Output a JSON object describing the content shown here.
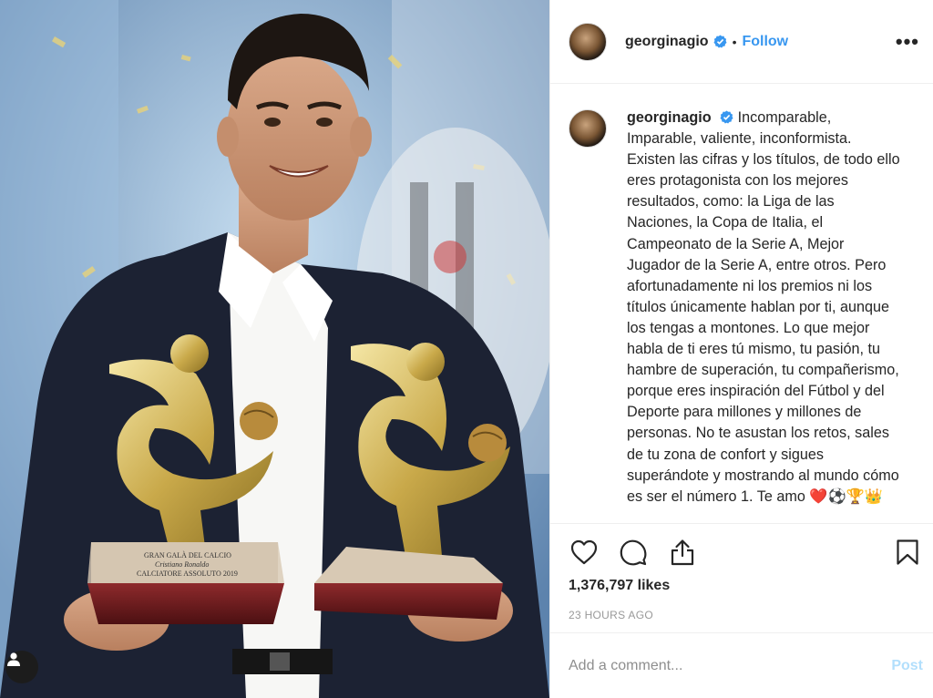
{
  "post": {
    "username": "georginagio",
    "follow_label": "Follow",
    "separator": "•",
    "more_label": "•••",
    "caption": "Incomparable, Imparable, valiente, inconformista. Existen las cifras y los títulos, de todo ello eres protagonista con los mejores resultados, como: la Liga de las Naciones, la Copa de Italia, el Campeonato de la Serie A, Mejor Jugador de la Serie A, entre otros. Pero afortunadamente ni los premios ni los títulos únicamente hablan por ti, aunque los tengas a montones. Lo que mejor habla de ti eres tú mismo, tu pasión, tu hambre de superación, tu compañerismo, porque eres inspiración del Fútbol y del Deporte para millones y millones de personas. No te asustan los retos, sales de tu zona de confort y sigues superándote y mostrando al mundo cómo es ser el número 1. Te amo ❤️⚽🏆👑",
    "likes": "1,376,797 likes",
    "timestamp": "23 HOURS AGO"
  },
  "trophy_plaque": {
    "line1": "GRAN GALÀ DEL CALCIO",
    "line2": "Cristiano Ronaldo",
    "line3": "CALCIATORE ASSOLUTO 2019"
  },
  "comment": {
    "placeholder": "Add a comment...",
    "post_label": "Post"
  },
  "icons": {
    "like": "heart-icon",
    "comment": "comment-icon",
    "share": "share-icon",
    "save": "bookmark-icon",
    "verified": "verified-badge-icon",
    "user_tags": "user-tag-icon"
  },
  "colors": {
    "link_blue": "#3897f0",
    "post_disabled": "#b2dffc",
    "verified_blue": "#3897f0",
    "muted_text": "#999999"
  }
}
